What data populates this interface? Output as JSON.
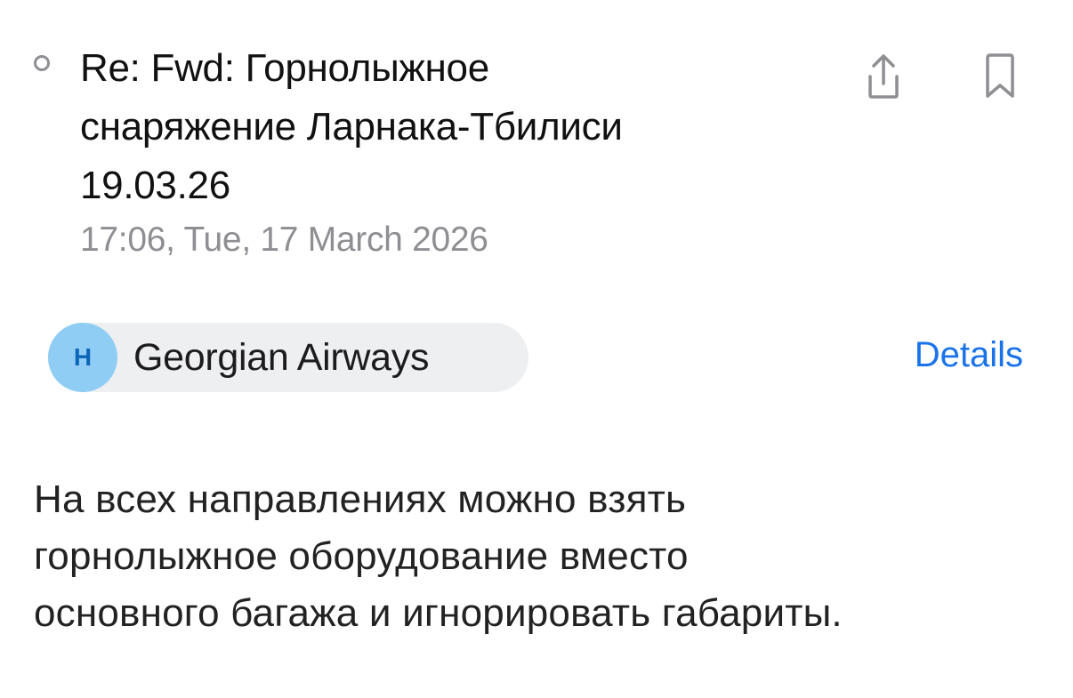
{
  "email": {
    "subject_lines": [
      "Re: Fwd: Горнолыжное",
      "снаряжение Ларнака-Тбилиси",
      "19.03.26"
    ],
    "timestamp": "17:06, Tue, 17 March 2026",
    "read_state": "read"
  },
  "actions": {
    "share_icon": "share-icon",
    "bookmark_icon": "bookmark-icon"
  },
  "sender": {
    "avatar_initial": "H",
    "name": "Georgian Airways",
    "details_label": "Details"
  },
  "body": {
    "lines": [
      "На всех направлениях можно взять",
      "горнолыжное оборудование вместо",
      "основного багажа и игнорировать габариты."
    ]
  },
  "colors": {
    "accent": "#1a73e8",
    "avatar_bg": "#90cdf4",
    "avatar_text": "#0b66b8",
    "muted_text": "#8e8e93",
    "chip_bg": "#eeeff1"
  }
}
